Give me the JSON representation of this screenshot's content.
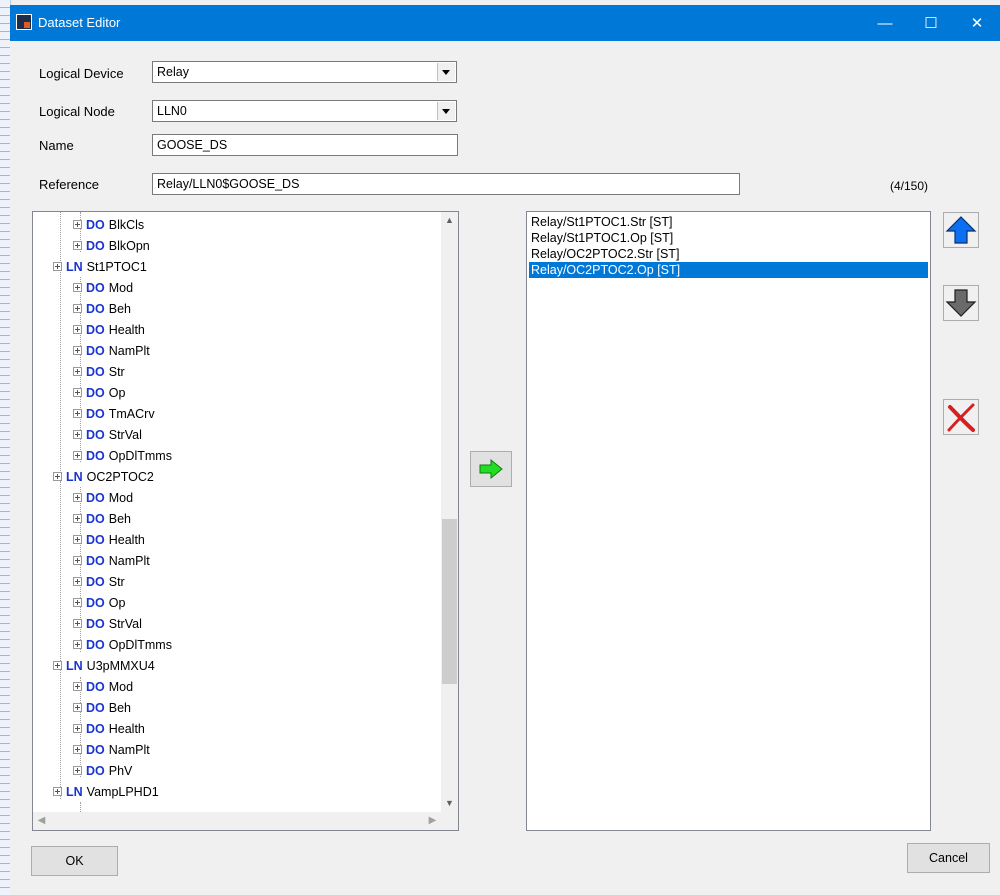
{
  "window": {
    "title": "Dataset Editor",
    "minimize": "—",
    "maximize": "☐",
    "close": "✕"
  },
  "form": {
    "logical_device_label": "Logical Device",
    "logical_device_value": "Relay",
    "logical_node_label": "Logical Node",
    "logical_node_value": "LLN0",
    "name_label": "Name",
    "name_value": "GOOSE_DS",
    "reference_label": "Reference",
    "reference_value": "Relay/LLN0$GOOSE_DS",
    "count": "(4/150)"
  },
  "tree": {
    "nodes": [
      {
        "type": "DO",
        "label": "BlkCls"
      },
      {
        "type": "DO",
        "label": "BlkOpn"
      },
      {
        "type": "LN",
        "label": "St1PTOC1"
      },
      {
        "type": "DO",
        "label": "Mod"
      },
      {
        "type": "DO",
        "label": "Beh"
      },
      {
        "type": "DO",
        "label": "Health"
      },
      {
        "type": "DO",
        "label": "NamPlt"
      },
      {
        "type": "DO",
        "label": "Str"
      },
      {
        "type": "DO",
        "label": "Op"
      },
      {
        "type": "DO",
        "label": "TmACrv"
      },
      {
        "type": "DO",
        "label": "StrVal"
      },
      {
        "type": "DO",
        "label": "OpDlTmms"
      },
      {
        "type": "LN",
        "label": "OC2PTOC2"
      },
      {
        "type": "DO",
        "label": "Mod"
      },
      {
        "type": "DO",
        "label": "Beh"
      },
      {
        "type": "DO",
        "label": "Health"
      },
      {
        "type": "DO",
        "label": "NamPlt"
      },
      {
        "type": "DO",
        "label": "Str"
      },
      {
        "type": "DO",
        "label": "Op"
      },
      {
        "type": "DO",
        "label": "StrVal"
      },
      {
        "type": "DO",
        "label": "OpDlTmms"
      },
      {
        "type": "LN",
        "label": "U3pMMXU4"
      },
      {
        "type": "DO",
        "label": "Mod"
      },
      {
        "type": "DO",
        "label": "Beh"
      },
      {
        "type": "DO",
        "label": "Health"
      },
      {
        "type": "DO",
        "label": "NamPlt"
      },
      {
        "type": "DO",
        "label": "PhV"
      },
      {
        "type": "LN",
        "label": "VampLPHD1"
      }
    ]
  },
  "dataset": {
    "items": [
      {
        "label": "Relay/St1PTOC1.Str [ST]",
        "selected": false
      },
      {
        "label": "Relay/St1PTOC1.Op [ST]",
        "selected": false
      },
      {
        "label": "Relay/OC2PTOC2.Str [ST]",
        "selected": false
      },
      {
        "label": "Relay/OC2PTOC2.Op [ST]",
        "selected": true
      }
    ]
  },
  "buttons": {
    "ok": "OK",
    "cancel": "Cancel"
  },
  "icons": {
    "add": "green-right-arrow-icon",
    "up": "blue-up-arrow-icon",
    "down": "gray-down-arrow-icon",
    "delete": "red-x-icon"
  },
  "colors": {
    "titlebar": "#0078d7",
    "selection": "#0078d7",
    "tree_tag": "#1a34d1",
    "add_arrow": "#22dd22",
    "up_arrow": "#0a6ff0",
    "delete_x": "#d42020"
  }
}
